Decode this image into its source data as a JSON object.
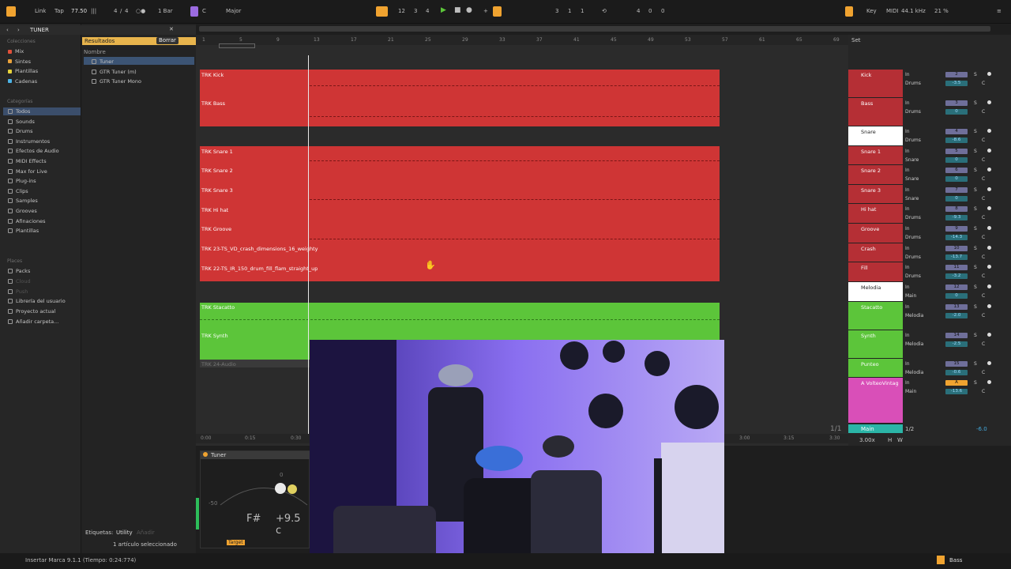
{
  "topbar": {
    "link": "Link",
    "tap": "Tap",
    "tempo": "77.50",
    "time_sig_num": "4",
    "time_sig_den": "4",
    "quant": "1 Bar",
    "key_root": "C",
    "key_scale": "Major",
    "position": [
      "12",
      "3",
      "4"
    ],
    "loop_start": [
      "3",
      "1",
      "1"
    ],
    "loop_len": [
      "4",
      "0",
      "0"
    ],
    "key_label": "Key",
    "midi_label": "MIDI",
    "sample_rate": "44.1 kHz",
    "cpu": "21 %"
  },
  "browser": {
    "search_tab": "TUNER",
    "collections_head": "Colecciones",
    "collections": [
      {
        "label": "Mix",
        "color": "#e0503a"
      },
      {
        "label": "Sintes",
        "color": "#e9a23b"
      },
      {
        "label": "Plantillas",
        "color": "#e7d33b"
      },
      {
        "label": "Cadenas",
        "color": "#4db3e6"
      }
    ],
    "categories_head": "Categorías",
    "categories": [
      "Todos",
      "Sounds",
      "Drums",
      "Instrumentos",
      "Efectos de Audio",
      "MIDI Effects",
      "Max for Live",
      "Plug-ins",
      "Clips",
      "Samples",
      "Grooves",
      "Afinaciones",
      "Plantillas"
    ],
    "places_head": "Places",
    "places": [
      "Packs",
      "Cloud",
      "Push",
      "Librería del usuario",
      "Proyecto actual",
      "Añadir carpeta..."
    ],
    "results_label": "Resultados",
    "clear_label": "Borrar",
    "name_col": "Nombre",
    "results": [
      "Tuner",
      "GTR Tuner (m)",
      "GTR Tuner Mono"
    ],
    "tags_label": "Etiquetas:",
    "tag_utility": "Utility",
    "tag_add": "Añadir",
    "selected_count": "1 artículo seleccionado"
  },
  "ruler": [
    "1",
    "5",
    "9",
    "13",
    "17",
    "21",
    "25",
    "29",
    "33",
    "37",
    "41",
    "45",
    "49",
    "53",
    "57",
    "61",
    "65",
    "69"
  ],
  "time_ruler": [
    "0:00",
    "0:15",
    "0:30",
    "3:00",
    "3:15",
    "3:30"
  ],
  "tracks": [
    {
      "name": "TRK Kick",
      "color": "#cf3535"
    },
    {
      "name": "TRK Bass",
      "color": "#cf3535"
    },
    {
      "name": "TRK Snare 1",
      "color": "#cf3535"
    },
    {
      "name": "TRK Snare 2",
      "color": "#cf3535"
    },
    {
      "name": "TRK Snare 3",
      "color": "#cf3535"
    },
    {
      "name": "TRK Hi hat",
      "color": "#cf3535"
    },
    {
      "name": "TRK Groove",
      "color": "#cf3535"
    },
    {
      "name": "TRK 23-TS_VD_crash_dimensions_16_weighty",
      "color": "#cf3535"
    },
    {
      "name": "TRK 22-TS_IR_150_drum_fill_flam_straight_up",
      "color": "#cf3535"
    },
    {
      "name": "TRK Stacatto",
      "color": "#5cc53a"
    },
    {
      "name": "TRK Synth",
      "color": "#5cc53a"
    },
    {
      "name": "TRK 24-Audio",
      "color": "#5cc53a"
    }
  ],
  "mixer": {
    "tab_label": "Set",
    "in_label": "In",
    "auto_label": "Auto",
    "off_label": "Off",
    "s_label": "S",
    "c_label": "C",
    "inf_label": "-inf",
    "channels": [
      {
        "name": "Kick",
        "route": "Drums",
        "num": "2",
        "vol": "-3.5",
        "color": "#b52f35"
      },
      {
        "name": "Bass",
        "route": "Drums",
        "num": "3",
        "vol": "0",
        "color": "#b52f35"
      },
      {
        "name": "Snare",
        "route": "Drums",
        "num": "4",
        "vol": "-8.6",
        "color": "#ffffff"
      },
      {
        "name": "Snare 1",
        "route": "Snare",
        "num": "5",
        "vol": "0",
        "color": "#b52f35"
      },
      {
        "name": "Snare 2",
        "route": "Snare",
        "num": "6",
        "vol": "0",
        "color": "#b52f35"
      },
      {
        "name": "Snare 3",
        "route": "Snare",
        "num": "7",
        "vol": "0",
        "color": "#b52f35"
      },
      {
        "name": "Hi hat",
        "route": "Drums",
        "num": "8",
        "vol": "-9.3",
        "color": "#b52f35"
      },
      {
        "name": "Groove",
        "route": "Drums",
        "num": "9",
        "vol": "-14.3",
        "color": "#b52f35"
      },
      {
        "name": "Crash",
        "route": "Drums",
        "num": "10",
        "vol": "-13.7",
        "color": "#b52f35"
      },
      {
        "name": "Fill",
        "route": "Drums",
        "num": "11",
        "vol": "-3.2",
        "color": "#b52f35"
      },
      {
        "name": "Melodia",
        "route": "Main",
        "num": "12",
        "vol": "0",
        "color": "#ffffff"
      },
      {
        "name": "Stacatto",
        "route": "Melodia",
        "num": "13",
        "vol": "-2.0",
        "color": "#5cc53a"
      },
      {
        "name": "Synth",
        "route": "Melodia",
        "num": "14",
        "vol": "-2.5",
        "color": "#5cc53a"
      },
      {
        "name": "Punteo",
        "route": "Melodia",
        "num": "15",
        "vol": "-0.6",
        "color": "#5cc53a"
      },
      {
        "name": "A VolteoVintag",
        "route": "Main",
        "num": "A",
        "vol": "-13.6",
        "color": "#d94fb8"
      }
    ],
    "main_label": "Main",
    "main_ratio": "1/2",
    "main_vol": "-6.0",
    "post_label": "Post",
    "tempo_small": "3.00x",
    "h_label": "H",
    "w_label": "W",
    "page_ratio": "1/1"
  },
  "tuner": {
    "title": "Tuner",
    "note": "F#",
    "cents": "+9.5 c",
    "scale_zero": "0",
    "scale_left": "-50",
    "target_label": "Target"
  },
  "status": {
    "message": "Insertar Marca 9.1.1 (Tiempo: 0:24:774)",
    "track_right": "Bass"
  },
  "colors": {
    "red": "#cf3535",
    "green": "#5cc53a",
    "orange": "#f0a330",
    "accent_blue": "#4a90d9",
    "teal": "#2bb5a7"
  }
}
